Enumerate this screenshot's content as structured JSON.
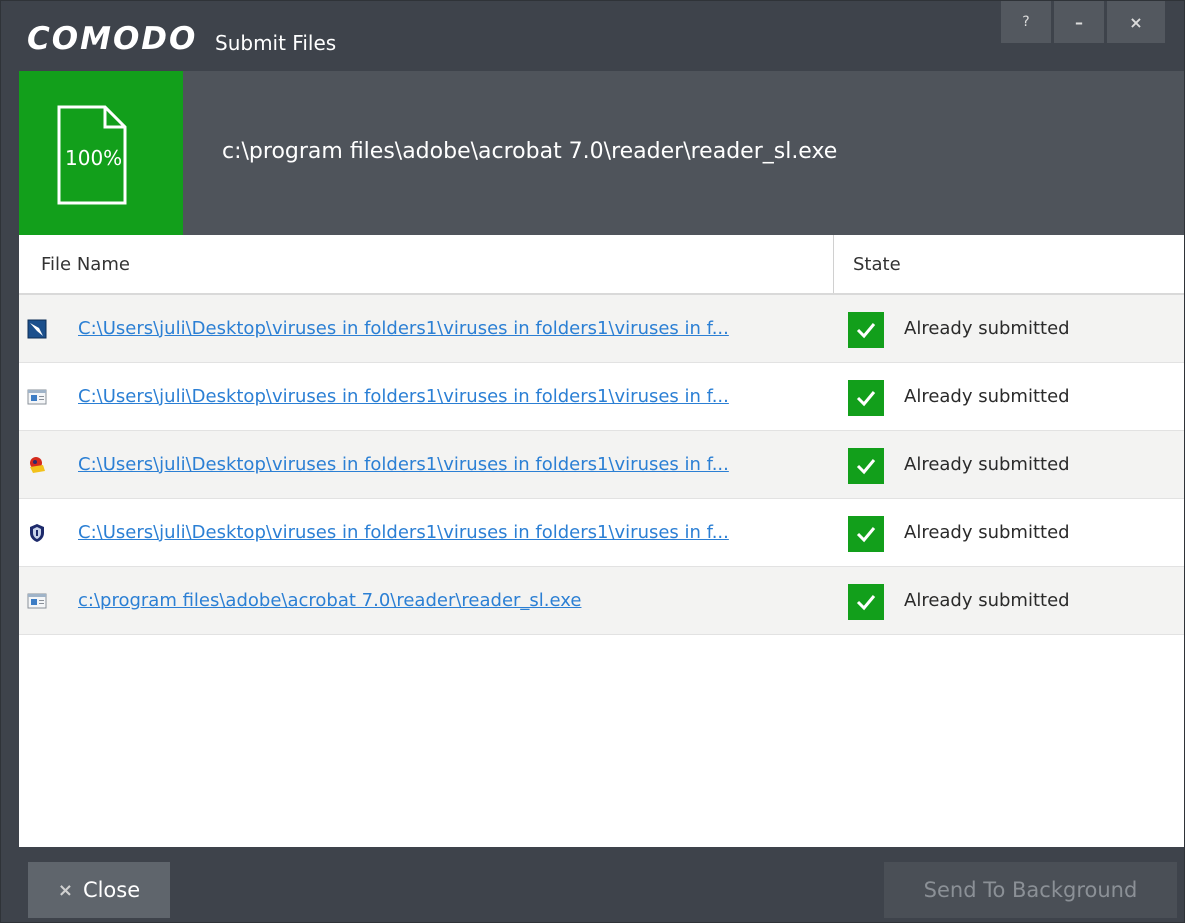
{
  "window": {
    "logo": "COMODO",
    "title": "Submit Files",
    "controls": {
      "help": "?",
      "minimize": "–",
      "close": "×"
    }
  },
  "progress": {
    "percent": "100%",
    "current_file": "c:\\program files\\adobe\\acrobat 7.0\\reader\\reader_sl.exe"
  },
  "table": {
    "columns": {
      "file_name": "File Name",
      "state": "State"
    },
    "rows": [
      {
        "icon": "blue-app-icon",
        "path": "C:\\Users\\juli\\Desktop\\viruses in folders1\\viruses in folders1\\viruses in f...",
        "state": "Already submitted"
      },
      {
        "icon": "window-app-icon",
        "path": "C:\\Users\\juli\\Desktop\\viruses in folders1\\viruses in folders1\\viruses in f...",
        "state": "Already submitted"
      },
      {
        "icon": "red-yellow-app-icon",
        "path": "C:\\Users\\juli\\Desktop\\viruses in folders1\\viruses in folders1\\viruses in f...",
        "state": "Already submitted"
      },
      {
        "icon": "shield-app-icon",
        "path": "C:\\Users\\juli\\Desktop\\viruses in folders1\\viruses in folders1\\viruses in f...",
        "state": "Already submitted"
      },
      {
        "icon": "window-app-icon",
        "path": "c:\\program files\\adobe\\acrobat 7.0\\reader\\reader_sl.exe",
        "state": "Already submitted"
      }
    ]
  },
  "footer": {
    "close_label": "Close",
    "close_icon": "×",
    "background_label": "Send To Background"
  },
  "colors": {
    "window_bg": "#3e434b",
    "progress_band": "#4f545b",
    "accent_green": "#129f1b",
    "link_blue": "#2b7fd4"
  }
}
